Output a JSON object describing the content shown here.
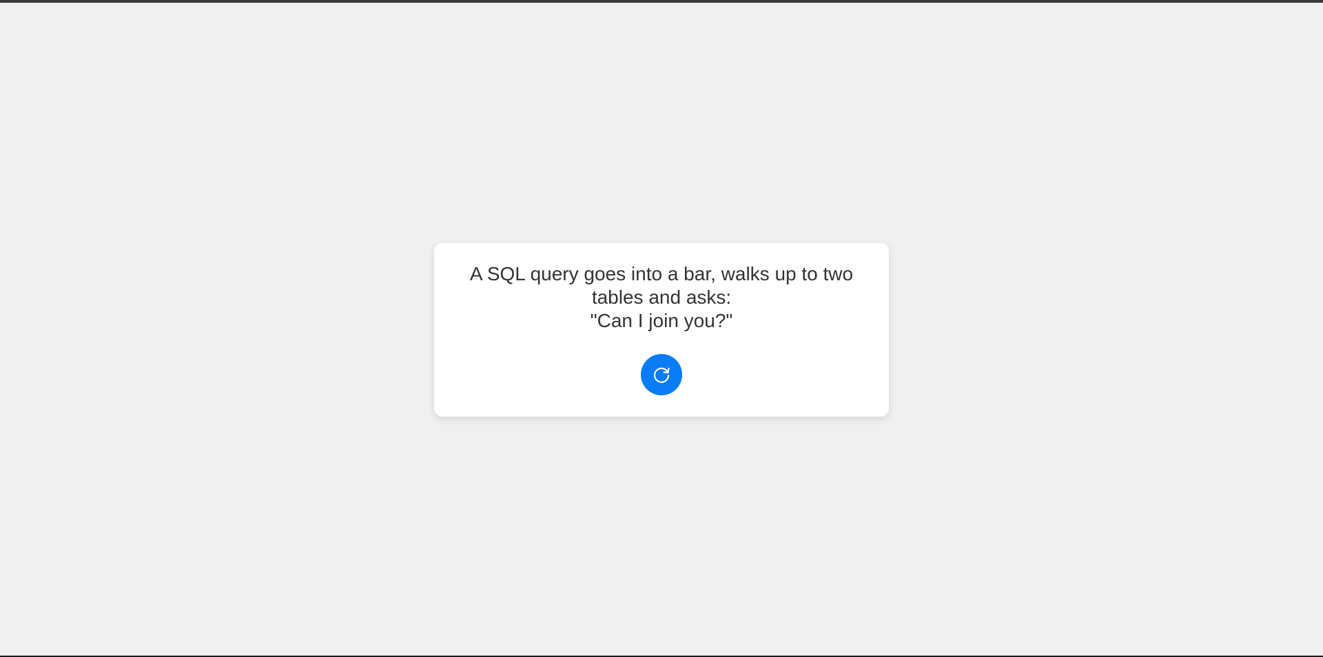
{
  "joke": {
    "setup": "A SQL query goes into a bar, walks up to two tables and asks:",
    "punchline": "\"Can I join you?\""
  },
  "refresh_button": {
    "icon": "refresh-icon",
    "color": "#0a7cf5"
  },
  "colors": {
    "background": "#f0f0f0",
    "card": "#ffffff",
    "text": "#333333"
  }
}
